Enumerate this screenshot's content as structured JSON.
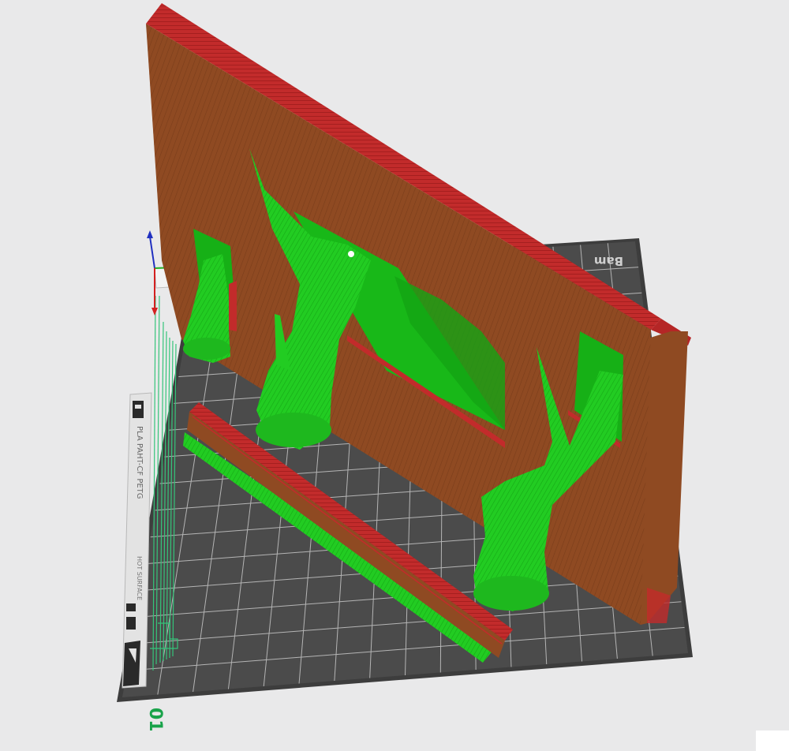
{
  "viewport": {
    "plate_number": "01",
    "bed_brand": "Bam",
    "bed_material_label": "PLA PAHT-CF PETG",
    "bed_notice": "HOT SURFACE",
    "colors": {
      "background": "#e9e9ea",
      "bed_surface": "#4b4b4b",
      "bed_grid": "#d8d8d8",
      "part_side": "#8f4a22",
      "part_top": "#c22b2b",
      "support": "#22cc22",
      "support_dark": "#129a12",
      "axis_x": "#d42020",
      "axis_y": "#22b022",
      "axis_z": "#2030c0",
      "plate_number": "#19a34a"
    },
    "icons": [
      "axis-gizmo-icon",
      "bed-lock-icon",
      "bed-arrow-icon"
    ]
  }
}
